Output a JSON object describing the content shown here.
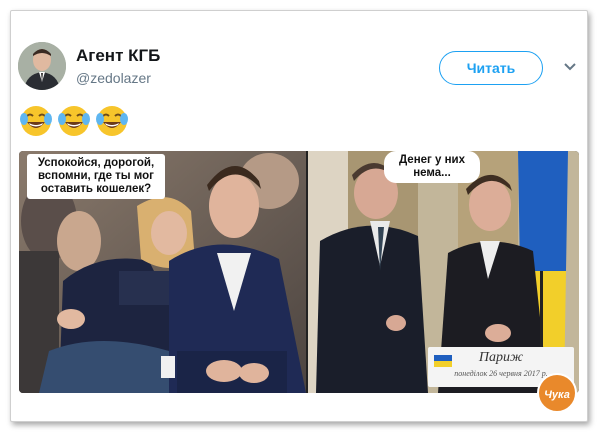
{
  "tweet": {
    "name": "Агент КГБ",
    "handle": "@zedolazer",
    "follow_label": "Читать",
    "emojis": [
      "face-with-tears-of-joy",
      "face-with-tears-of-joy",
      "face-with-tears-of-joy"
    ]
  },
  "meme": {
    "left_caption": "Успокойся, дорогой, вспомни, где ты мог оставить кошелек?",
    "right_caption": "Денег у них нема...",
    "sign_title": "Париж",
    "sign_subtitle": "понеділок 26 червня 2017 р."
  },
  "watermark": {
    "text": "Чука"
  },
  "colors": {
    "accent": "#1da1f2",
    "emoji": "#f7c52b"
  }
}
